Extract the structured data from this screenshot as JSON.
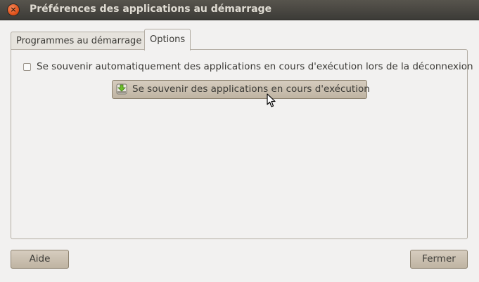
{
  "window": {
    "title": "Préférences des applications au démarrage",
    "close_icon": "close-icon"
  },
  "tabs": [
    {
      "label": "Programmes au démarrage",
      "selected": false
    },
    {
      "label": "Options",
      "selected": true
    }
  ],
  "options": {
    "auto_remember_label": "Se souvenir automatiquement des applications en cours d'exécution lors de la déconnexion",
    "auto_remember_checked": false,
    "remember_button_label": "Se souvenir des applications en cours d'exécution",
    "remember_button_icon": "download-icon"
  },
  "footer": {
    "help_label": "Aide",
    "close_label": "Fermer"
  }
}
